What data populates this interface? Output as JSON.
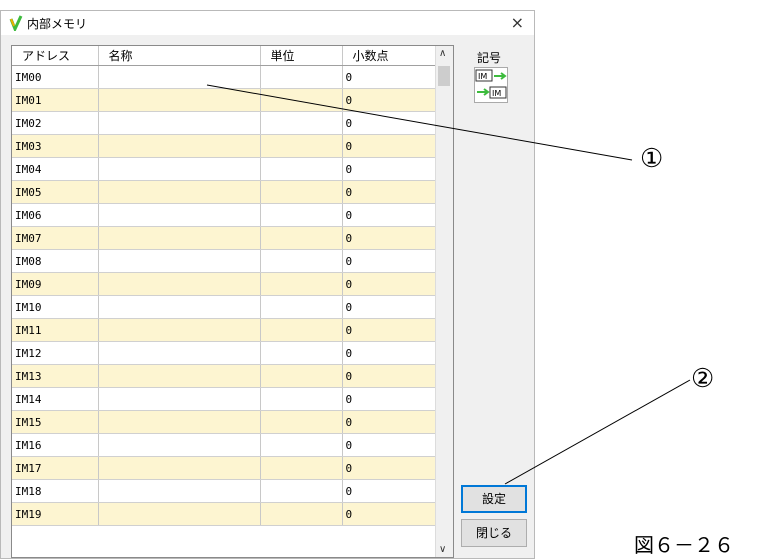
{
  "window": {
    "title": "内部メモリ",
    "close_glyph": "×"
  },
  "table": {
    "headers": [
      "アドレス",
      "名称",
      "単位",
      "小数点"
    ],
    "rows": [
      {
        "addr": "IM00",
        "name": "",
        "unit": "",
        "dec": "0"
      },
      {
        "addr": "IM01",
        "name": "",
        "unit": "",
        "dec": "0"
      },
      {
        "addr": "IM02",
        "name": "",
        "unit": "",
        "dec": "0"
      },
      {
        "addr": "IM03",
        "name": "",
        "unit": "",
        "dec": "0"
      },
      {
        "addr": "IM04",
        "name": "",
        "unit": "",
        "dec": "0"
      },
      {
        "addr": "IM05",
        "name": "",
        "unit": "",
        "dec": "0"
      },
      {
        "addr": "IM06",
        "name": "",
        "unit": "",
        "dec": "0"
      },
      {
        "addr": "IM07",
        "name": "",
        "unit": "",
        "dec": "0"
      },
      {
        "addr": "IM08",
        "name": "",
        "unit": "",
        "dec": "0"
      },
      {
        "addr": "IM09",
        "name": "",
        "unit": "",
        "dec": "0"
      },
      {
        "addr": "IM10",
        "name": "",
        "unit": "",
        "dec": "0"
      },
      {
        "addr": "IM11",
        "name": "",
        "unit": "",
        "dec": "0"
      },
      {
        "addr": "IM12",
        "name": "",
        "unit": "",
        "dec": "0"
      },
      {
        "addr": "IM13",
        "name": "",
        "unit": "",
        "dec": "0"
      },
      {
        "addr": "IM14",
        "name": "",
        "unit": "",
        "dec": "0"
      },
      {
        "addr": "IM15",
        "name": "",
        "unit": "",
        "dec": "0"
      },
      {
        "addr": "IM16",
        "name": "",
        "unit": "",
        "dec": "0"
      },
      {
        "addr": "IM17",
        "name": "",
        "unit": "",
        "dec": "0"
      },
      {
        "addr": "IM18",
        "name": "",
        "unit": "",
        "dec": "0"
      },
      {
        "addr": "IM19",
        "name": "",
        "unit": "",
        "dec": "0"
      }
    ]
  },
  "side": {
    "symbol_label": "記号",
    "icon_text_top": "IM",
    "icon_text_bottom": "IM",
    "set_button": "設定",
    "close_button": "閉じる"
  },
  "callouts": {
    "one": "①",
    "two": "②"
  },
  "figure_caption": "図６－２６",
  "colors": {
    "alt_row": "#fdf5d1",
    "accent": "#0078d7",
    "title_icon": "#3dbb3d"
  }
}
